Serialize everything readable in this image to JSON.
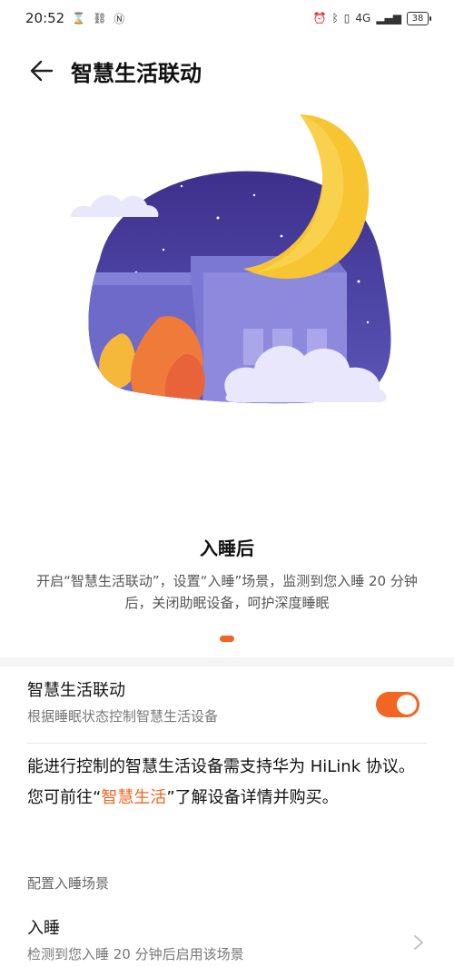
{
  "status_bar": {
    "time": "20:52",
    "left_icons": [
      "hourglass-icon",
      "link-icon",
      "nfc-icon"
    ],
    "right_icons": [
      "alarm-icon",
      "bluetooth-icon",
      "vibrate-icon",
      "signal-4g-icon"
    ],
    "network": "4G",
    "battery": "38"
  },
  "header": {
    "title": "智慧生活联动"
  },
  "card": {
    "title": "入睡后",
    "description": "开启“智慧生活联动”，设置“入睡”场景，监测到您入睡 20 分钟后，关闭助眠设备，呵护深度睡眠",
    "page_indicator_color": "#f26522"
  },
  "toggle": {
    "title": "智慧生活联动",
    "subtitle": "根据睡眠状态控制智慧生活设备",
    "on": true,
    "color": "#f26522"
  },
  "info": {
    "prefix": "能进行控制的智慧生活设备需支持华为 HiLink 协议。您可前往“",
    "link": "智慧生活",
    "suffix": "”了解设备详情并购买。"
  },
  "section": {
    "label": "配置入睡场景"
  },
  "scene": {
    "title": "入睡",
    "subtitle": "检测到您入睡 20 分钟后启用该场景"
  },
  "colors": {
    "accent": "#f26522",
    "night_sky": "#4a3f9a",
    "moon": "#f7c531"
  }
}
